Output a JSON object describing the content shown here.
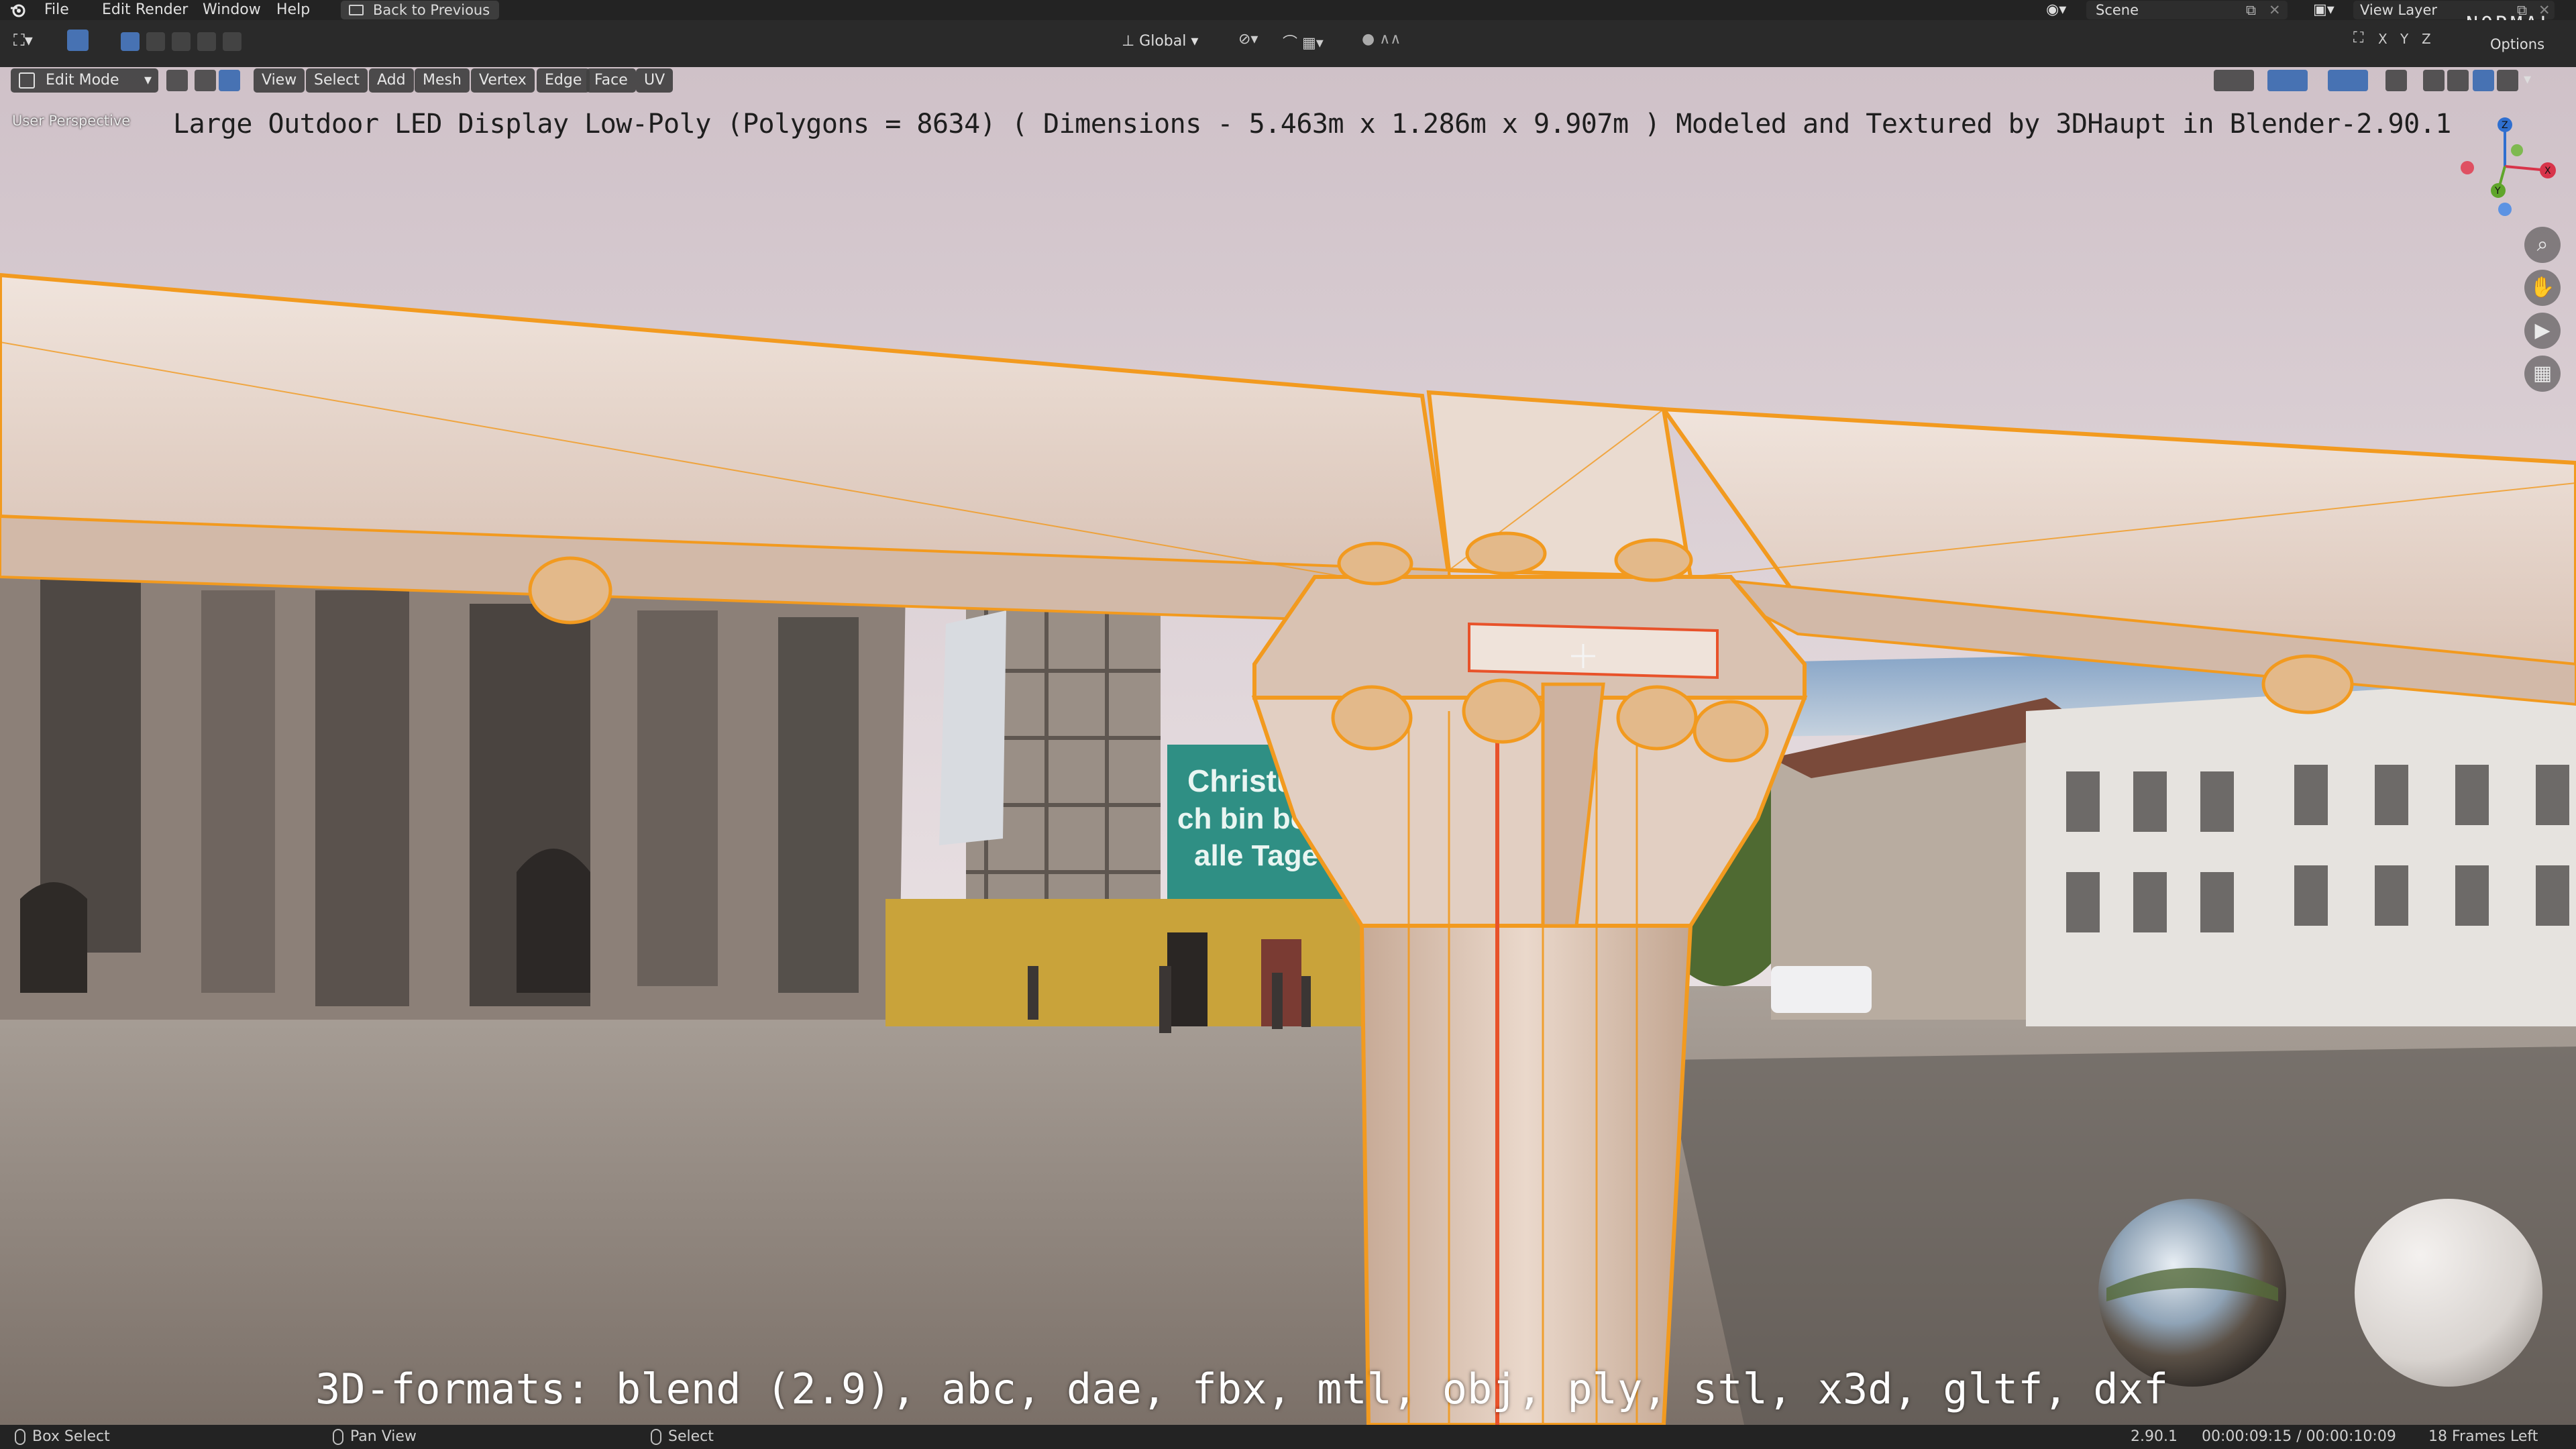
{
  "menu": {
    "items": [
      "File",
      "Edit",
      "Render",
      "Window",
      "Help"
    ],
    "back_label": "Back to Previous"
  },
  "header": {
    "transform_orientation": "Global",
    "scene_label": "Scene",
    "view_layer_label": "View Layer",
    "axes": [
      "X",
      "Y",
      "Z"
    ],
    "options_label": "Options",
    "normal_tag": "NORMAL"
  },
  "editbar": {
    "mode": "Edit Mode",
    "menus": [
      "View",
      "Select",
      "Add",
      "Mesh",
      "Vertex",
      "Edge",
      "Face",
      "UV"
    ]
  },
  "viewport": {
    "perspective": "User Perspective",
    "title": "Large Outdoor LED Display Low-Poly (Polygons = 8634) ( Dimensions -  5.463m x 1.286m x 9.907m ) Modeled and Textured by 3DHaupt in Blender-2.90.1",
    "formats": "3D-formats: blend (2.9), abc, dae, fbx, mtl, obj, ply, stl, x3d, gltf, dxf",
    "background_sign": [
      "Christus",
      "ch bin bei",
      "alle Tage"
    ],
    "gizmo_axes": {
      "x": "X",
      "y": "Y",
      "z": "Z"
    }
  },
  "status": {
    "left_action": "Box Select",
    "middle_action": "Pan View",
    "right_action": "Select",
    "version": "2.90.1",
    "time": "00:00:09:15 / 00:00:10:09",
    "frames_left": "18 Frames Left"
  },
  "colors": {
    "selection_orange": "#f29a1f",
    "active_edge_red": "#e8522a",
    "blender_blue": "#4772b3",
    "header_bg": "#2a2a2a"
  }
}
